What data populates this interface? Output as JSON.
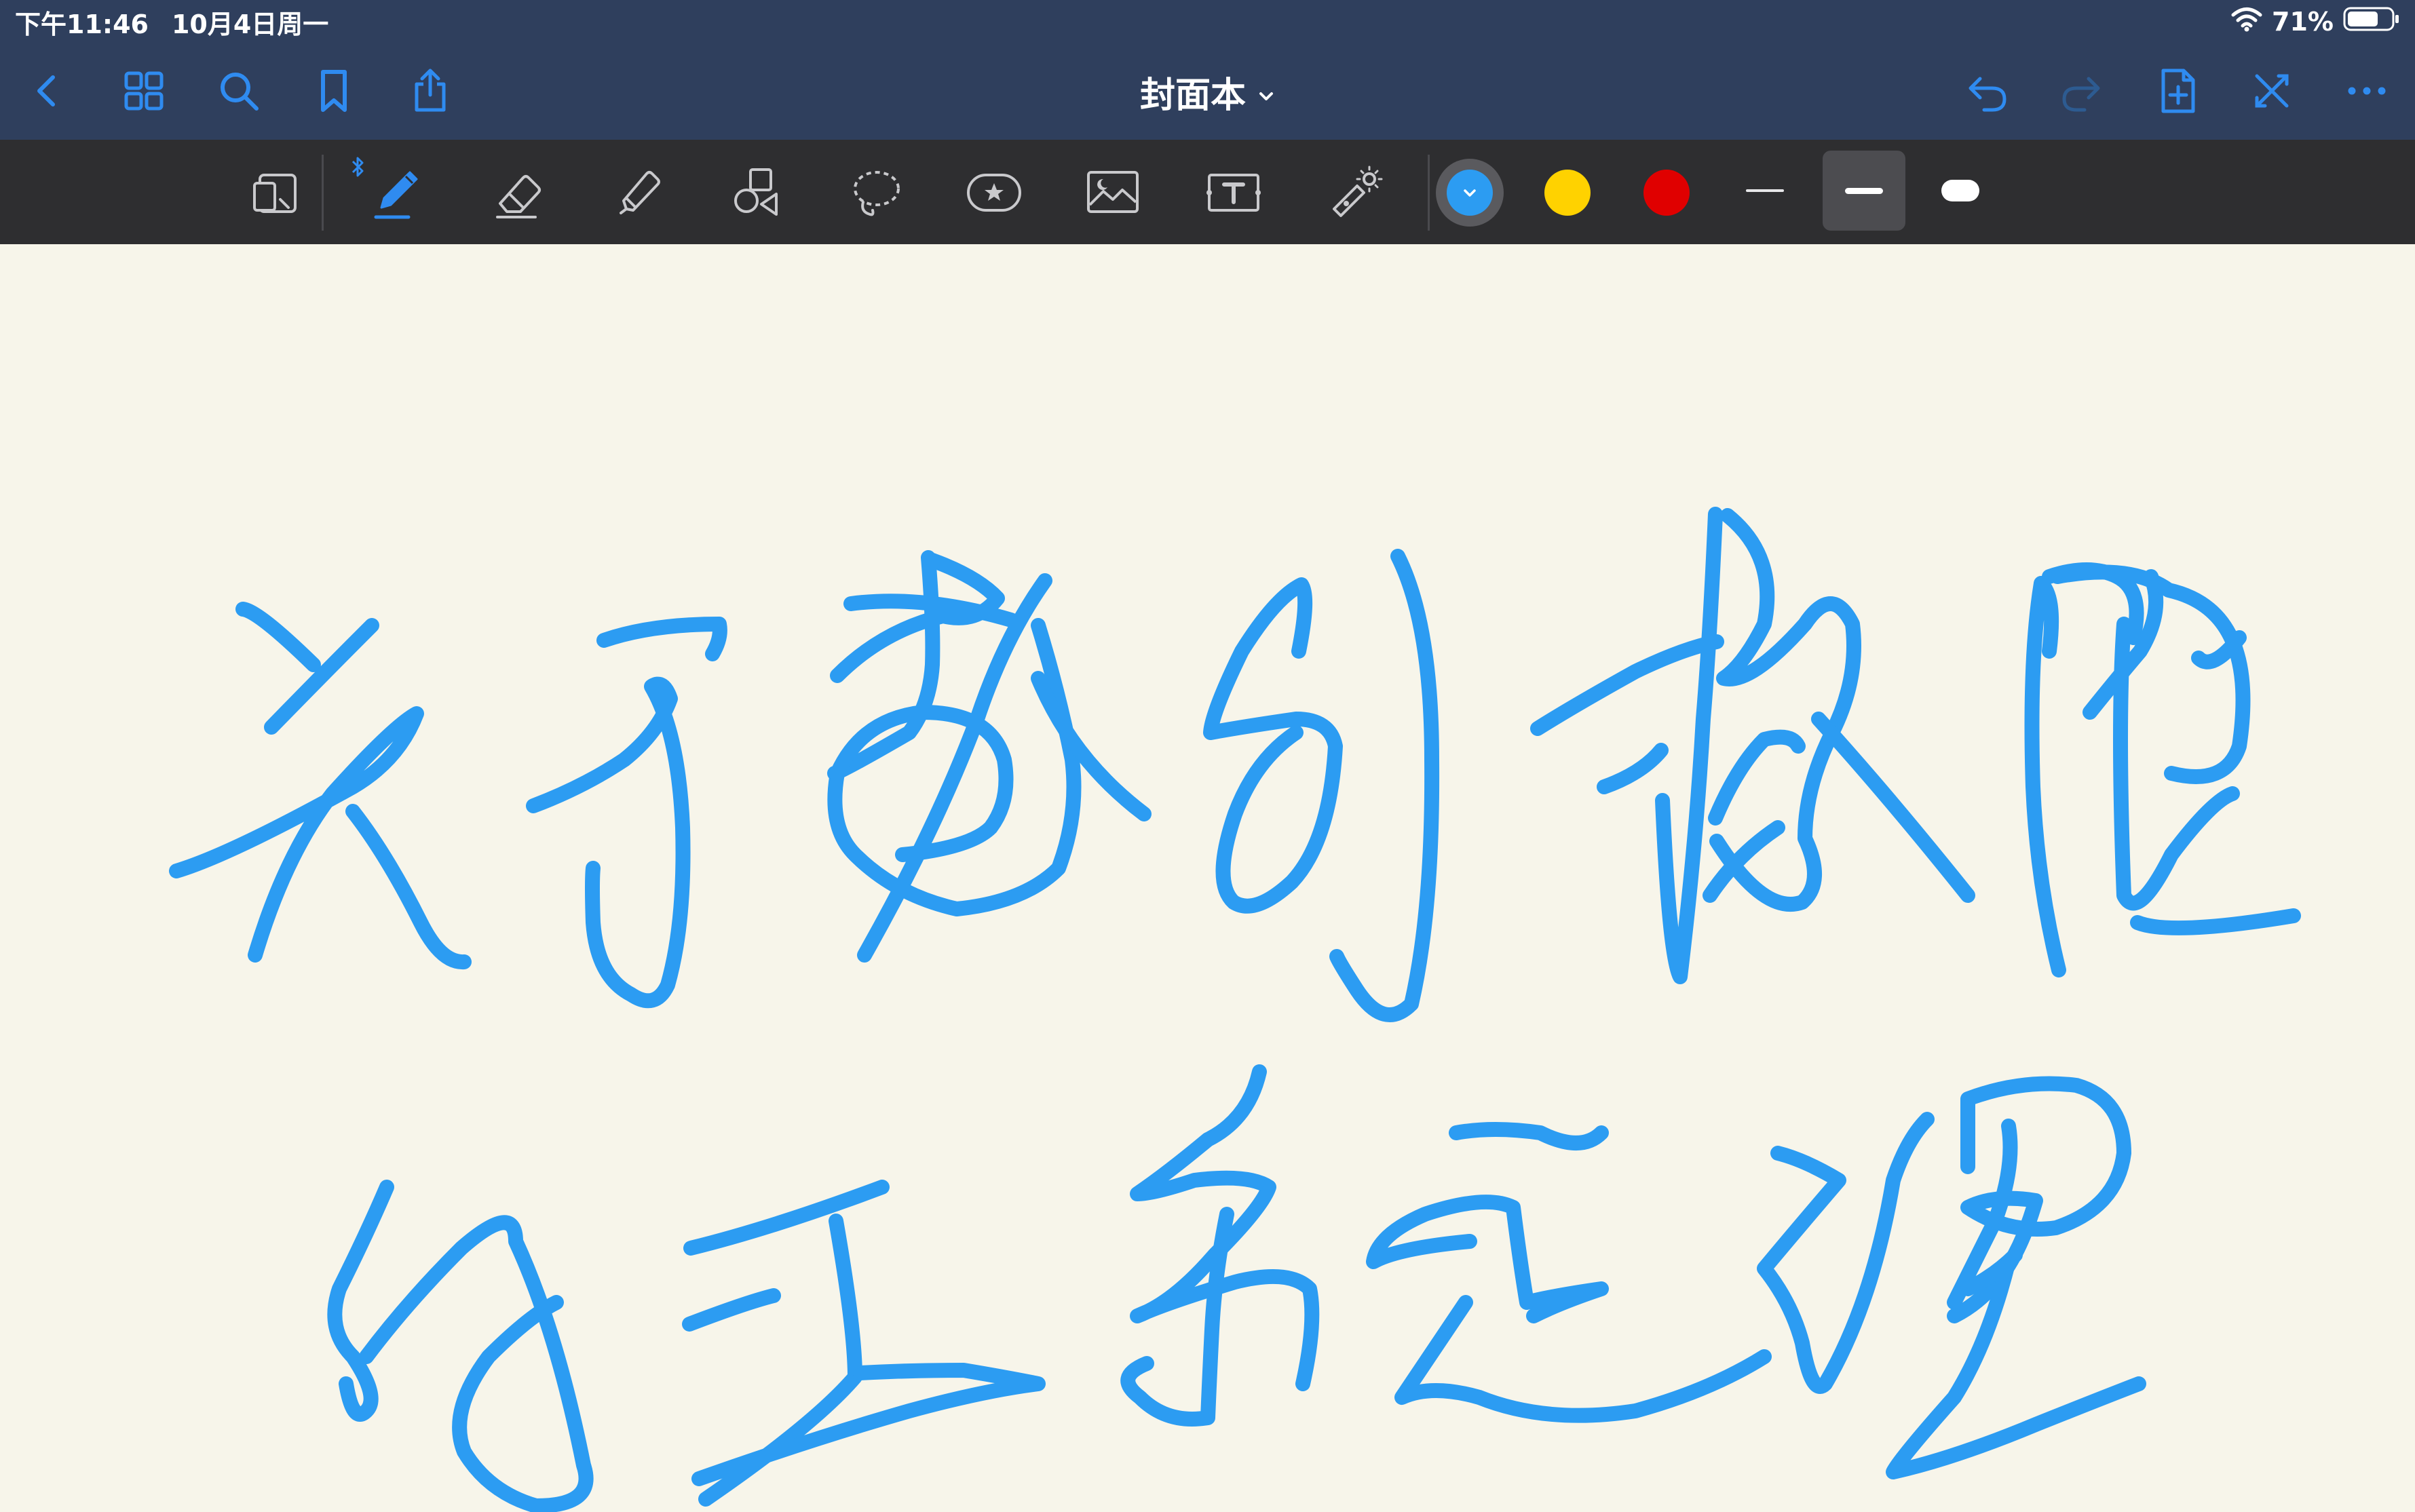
{
  "status_bar": {
    "time": "下午11:46",
    "date": "10月4日周一",
    "battery_percent": "71%",
    "battery_level": 0.71,
    "wifi_icon": "wifi-icon"
  },
  "nav": {
    "document_title": "封面本",
    "left_icons": [
      "back-chevron-icon",
      "grid-icon",
      "search-icon",
      "bookmark-icon",
      "share-icon"
    ],
    "right_icons": [
      "undo-icon",
      "redo-icon",
      "add-page-icon",
      "close-x-icon",
      "more-icon"
    ]
  },
  "toolbar": {
    "tools": [
      "read-mode-icon",
      "pen-icon",
      "eraser-icon",
      "highlighter-icon",
      "shapes-icon",
      "lasso-icon",
      "sticker-icon",
      "image-icon",
      "text-icon",
      "laser-pointer-icon"
    ],
    "selected_tool": "pen-icon",
    "bluetooth_icon": "bluetooth-icon",
    "colors": [
      "#2c9cf2",
      "#ffd200",
      "#e00000"
    ],
    "selected_color": "#2c9cf2",
    "thickness_options": [
      "thin",
      "medium",
      "thick"
    ],
    "selected_thickness": "medium"
  },
  "canvas": {
    "background_color": "#f7f5ea",
    "ink_color": "#2c9cf2",
    "handwriting_line1": "关于数列极限",
    "handwriting_line2": "的五个定理"
  }
}
